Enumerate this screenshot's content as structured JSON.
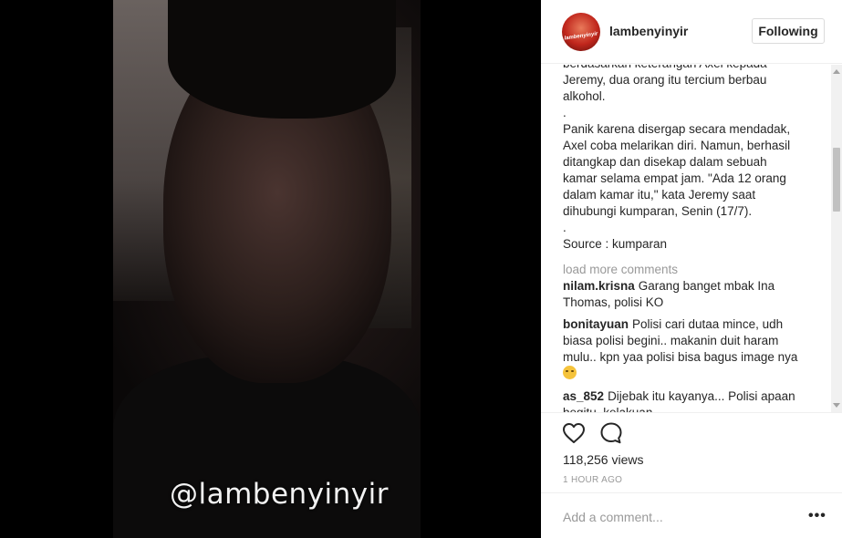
{
  "video": {
    "watermark": "@lambenyinyir"
  },
  "post": {
    "username": "lambenyinyir",
    "follow_label": "Following",
    "avatar_text": "lambenyinyir",
    "caption_lines": [
      "berdasarkan keterangan Axel kepada",
      "Jeremy, dua orang itu tercium berbau",
      "alkohol.",
      ".",
      "Panik karena disergap secara mendadak,",
      "Axel coba melarikan diri. Namun, berhasil",
      "ditangkap dan disekap dalam sebuah",
      "kamar selama empat jam. \"Ada 12 orang",
      "dalam kamar itu,\" kata Jeremy saat",
      "dihubungi kumparan, Senin (17/7).",
      ".",
      "Source : kumparan"
    ],
    "load_more": "load more comments",
    "comments": [
      {
        "user": "nilam.krisna",
        "text": "Garang banget mbak Ina Thomas, polisi KO"
      },
      {
        "user": "bonitayuan",
        "text": "Polisi cari dutaa mince, udh biasa polisi begini.. makanin duit haram mulu.. kpn yaa polisi bisa bagus image nya"
      },
      {
        "user": "as_852",
        "text": "Dijebak itu kayanya... Polisi apaan begitu, kelakuan"
      }
    ],
    "views": "118,256 views",
    "time": "1 HOUR AGO",
    "add_comment_placeholder": "Add a comment...",
    "more_label": "•••"
  }
}
